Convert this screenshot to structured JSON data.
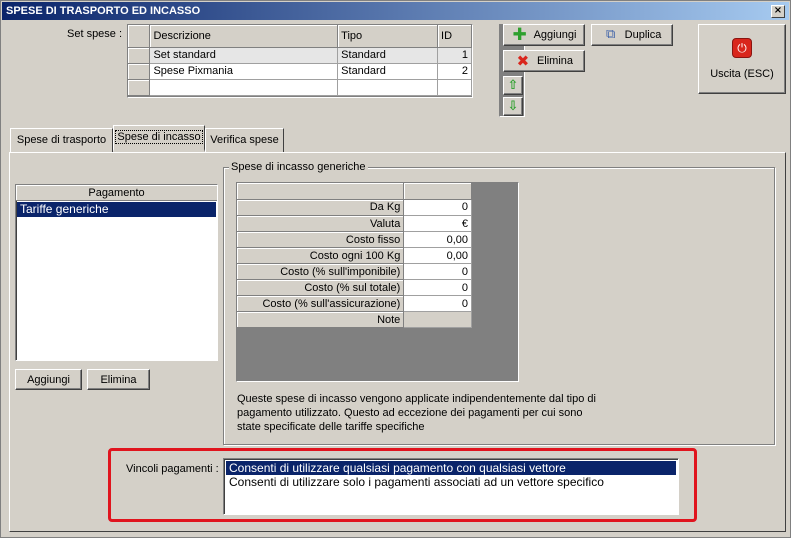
{
  "window": {
    "title": "SPESE DI TRASPORTO ED INCASSO",
    "close_glyph": "×"
  },
  "set_spese": {
    "label": "Set spese :",
    "columns": [
      "Descrizione",
      "Tipo",
      "ID"
    ],
    "rows": [
      {
        "descrizione": "Set standard",
        "tipo": "Standard",
        "id": "1"
      },
      {
        "descrizione": "Spese Pixmania",
        "tipo": "Standard",
        "id": "2"
      }
    ]
  },
  "buttons": {
    "aggiungi": "Aggiungi",
    "duplica": "Duplica",
    "elimina": "Elimina",
    "uscita": "Uscita (ESC)",
    "pag_aggiungi": "Aggiungi",
    "pag_elimina": "Elimina"
  },
  "icons": {
    "aggiungi": "plus-icon",
    "duplica": "copy-icon",
    "elimina": "delete-x-icon",
    "up": "arrow-up-icon",
    "down": "arrow-down-icon",
    "uscita": "power-icon"
  },
  "colors": {
    "accent_green": "#2ea02e",
    "accent_red": "#d9261c",
    "selection": "#0a246a",
    "highlight_box": "#e0141e"
  },
  "tabs": [
    {
      "label": "Spese di trasporto"
    },
    {
      "label": "Spese di incasso"
    },
    {
      "label": "Verifica spese"
    }
  ],
  "pagamento": {
    "header": "Pagamento",
    "items": [
      "Tariffe generiche"
    ]
  },
  "generic_costs": {
    "group_title": "Spese di incasso generiche",
    "rows": [
      {
        "label": "Da Kg",
        "value": "0"
      },
      {
        "label": "Valuta",
        "value": "€"
      },
      {
        "label": "Costo fisso",
        "value": "0,00"
      },
      {
        "label": "Costo ogni 100 Kg",
        "value": "0,00"
      },
      {
        "label": "Costo (% sull'imponibile)",
        "value": "0"
      },
      {
        "label": "Costo (% sul totale)",
        "value": "0"
      },
      {
        "label": "Costo (% sull'assicurazione)",
        "value": "0"
      },
      {
        "label": "Note",
        "value": ""
      }
    ],
    "description_lines": [
      "Queste spese di incasso vengono applicate indipendentemente dal tipo di",
      "pagamento utilizzato. Questo ad eccezione dei pagamenti per cui sono",
      "state specificate delle tariffe specifiche"
    ]
  },
  "vincoli": {
    "label": "Vincoli pagamenti :",
    "options": [
      "Consenti di utilizzare qualsiasi pagamento con qualsiasi vettore",
      "Consenti di utilizzare solo i pagamenti associati ad un vettore specifico"
    ]
  }
}
